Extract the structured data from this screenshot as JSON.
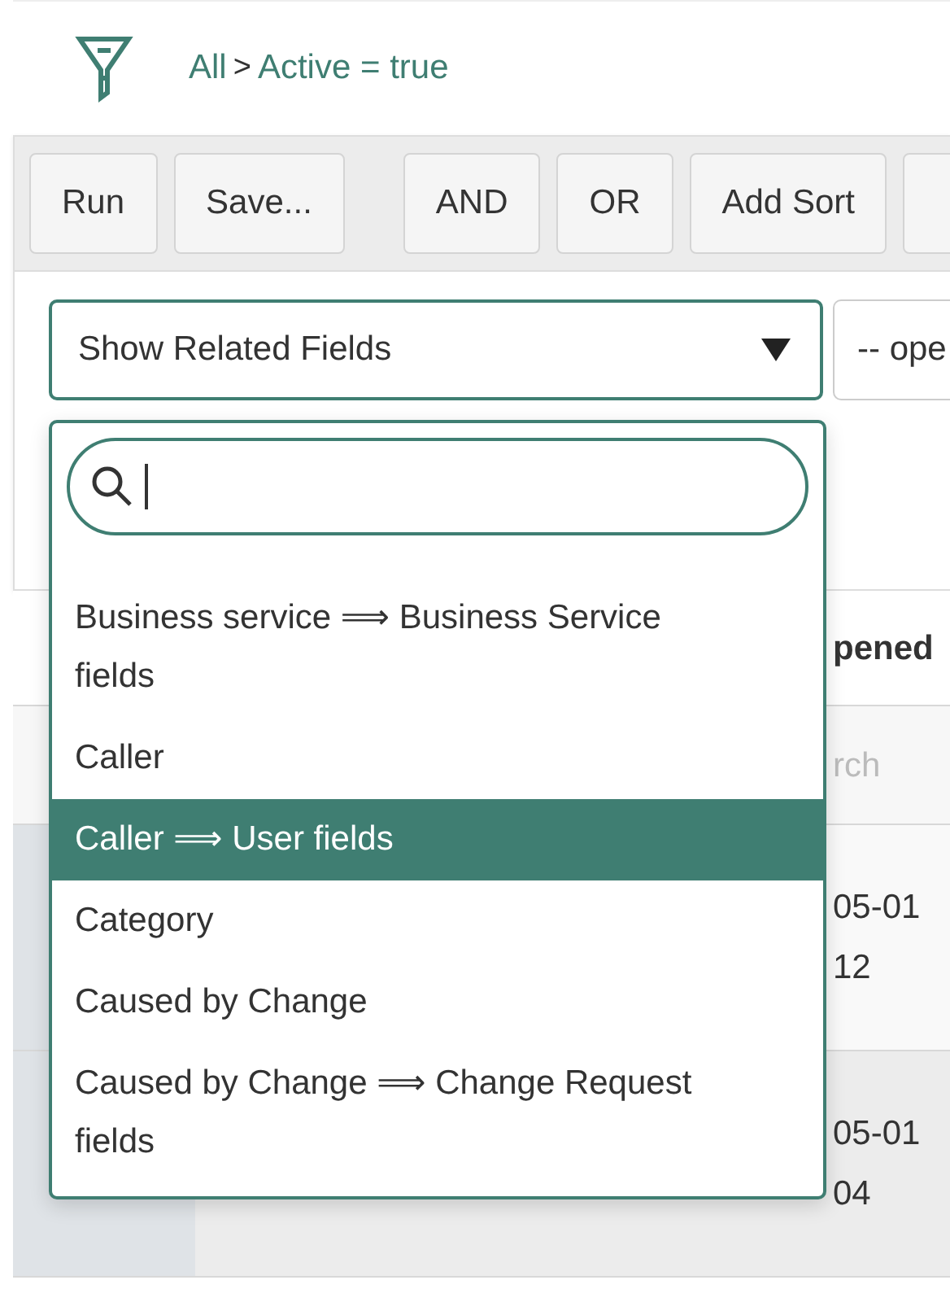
{
  "breadcrumb": {
    "items": [
      "All",
      "Active = true"
    ],
    "separator": ">"
  },
  "toolbar": {
    "buttons": [
      "Run",
      "Save...",
      "AND",
      "OR",
      "Add Sort"
    ]
  },
  "condition": {
    "field": "Show Related Fields",
    "operator": "-- ope"
  },
  "dropdown": {
    "items": [
      {
        "label": "Business service ⟹ Business Service fields",
        "selected": false
      },
      {
        "label": "Caller",
        "selected": false
      },
      {
        "label": "Caller ⟹ User fields",
        "selected": true
      },
      {
        "label": "Category",
        "selected": false
      },
      {
        "label": "Caused by Change",
        "selected": false
      },
      {
        "label": "Caused by Change ⟹ Change Request fields",
        "selected": false
      }
    ]
  },
  "list": {
    "header": "pened",
    "search_placeholder": "rch",
    "rows": [
      {
        "lines": [
          "05-01",
          "12"
        ]
      },
      {
        "lines": [
          "05-01",
          "04"
        ]
      }
    ]
  }
}
